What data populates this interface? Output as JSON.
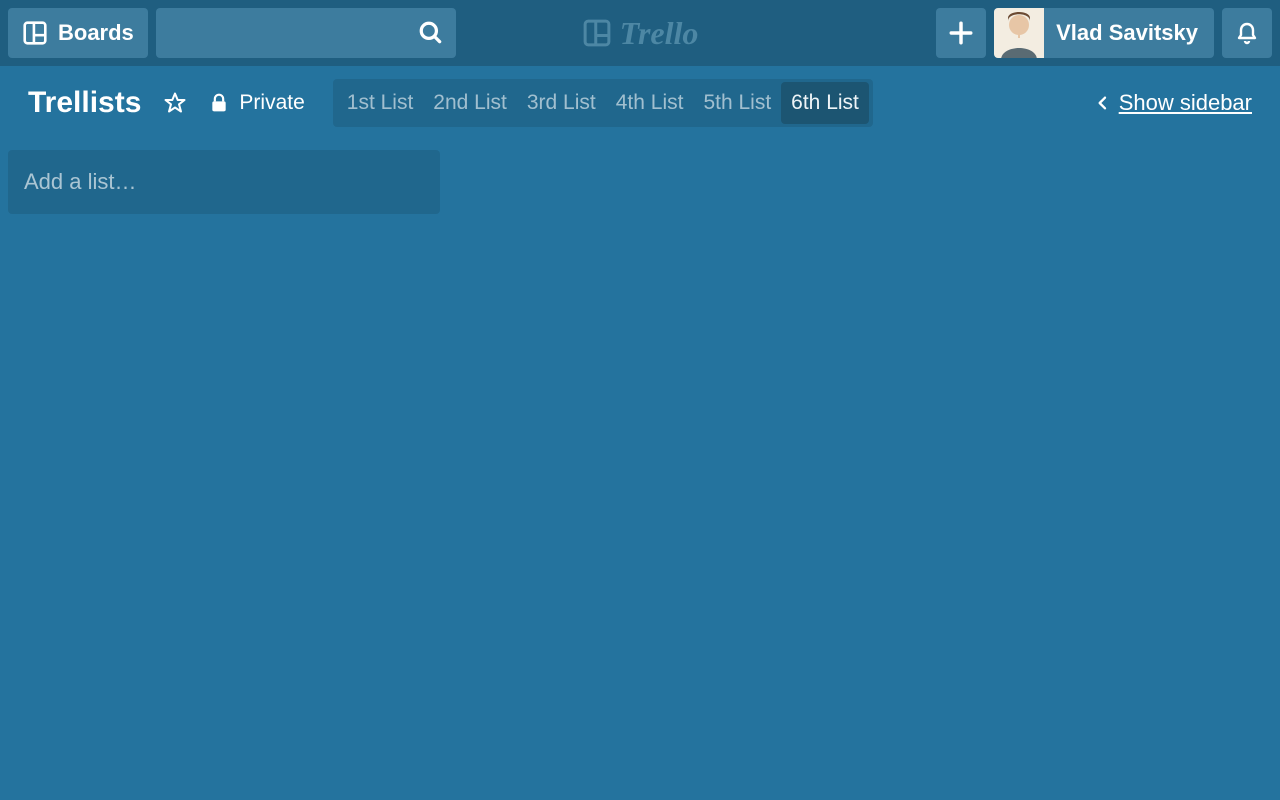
{
  "nav": {
    "boards_label": "Boards",
    "brand_name": "Trello",
    "user_name": "Vlad Savitsky"
  },
  "board": {
    "title": "Trellists",
    "visibility_label": "Private",
    "show_sidebar_label": "Show sidebar",
    "add_list_placeholder": "Add a list…",
    "tabs": [
      {
        "label": "1st List",
        "active": false
      },
      {
        "label": "2nd List",
        "active": false
      },
      {
        "label": "3rd List",
        "active": false
      },
      {
        "label": "4th List",
        "active": false
      },
      {
        "label": "5th List",
        "active": false
      },
      {
        "label": "6th List",
        "active": true
      }
    ]
  },
  "colors": {
    "bg": "#24739e",
    "nav_bg": "#1f5e80",
    "chip_bg": "#3d7c9e",
    "tab_active_bg": "#1c5572"
  }
}
